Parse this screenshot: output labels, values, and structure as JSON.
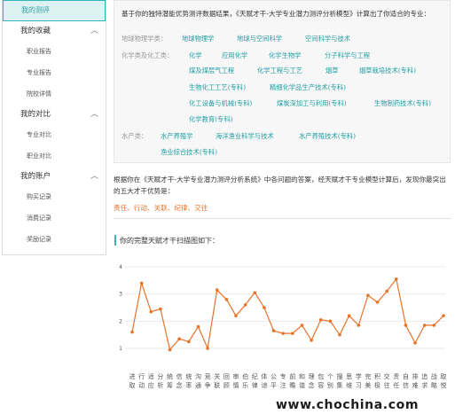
{
  "sidebar": {
    "active_item": "我的测评",
    "groups": [
      {
        "label": "我的收藏",
        "items": [
          "职业报告",
          "专业报告",
          "院校详情"
        ]
      },
      {
        "label": "我的对比",
        "items": [
          "专业对比",
          "职业对比"
        ]
      },
      {
        "label": "我的账户",
        "items": [
          "购买记录",
          "消费记录",
          "奖励记录"
        ]
      }
    ]
  },
  "recommend": {
    "intro": "基于你的独特潜能优势测评数据结果，《天赋才干-大学专业潜力测评分析模型》计算出了你适合的专业：",
    "categories": [
      {
        "label": "地球物理学类：",
        "items": [
          "地球物理学",
          "地球与空间科学",
          "空间科学与技术"
        ]
      },
      {
        "label": "化学类及化工类：",
        "items": [
          "化学",
          "应用化学",
          "化学生物学",
          "分子科学与工程",
          "煤及煤层气工程",
          "化学工程与工艺",
          "烟草",
          "烟草栽培技术(专科)",
          "生物化工工艺(专科)",
          "精细化学品生产技术(专科)",
          "化工设备与机械(专科)",
          "煤炭深加工与利用(专科)",
          "生物制药技术(专科)",
          "化学教育(专科)"
        ]
      },
      {
        "label": "水产类：",
        "items": [
          "水产养殖学",
          "海洋渔业科学与技术",
          "水产养殖技术(专科)",
          "渔业综合技术(专科)"
        ]
      }
    ]
  },
  "result": {
    "text": "根据你在《天赋才干-大学专业潜力测评分析系统》中各问题的答案，经天赋才干专业模型计算后，发现你最突出的五大才干优势是：",
    "talents": "责任、行动、关联、纪律、交往"
  },
  "chart_title": "你的完整天赋才干扫描图如下：",
  "chart_data": {
    "type": "line",
    "categories": [
      "进取",
      "行动",
      "适应",
      "分析",
      "统筹",
      "信念",
      "统率",
      "沟通",
      "竞争",
      "关联",
      "回顾",
      "审慎",
      "伯乐",
      "纪律",
      "体谅",
      "公平",
      "专注",
      "前瞻",
      "和谐",
      "理念",
      "包容",
      "个别",
      "搜集",
      "思维",
      "学习",
      "完美",
      "积极",
      "交往",
      "责任",
      "自信",
      "排难",
      "追求",
      "战略",
      "取悦"
    ],
    "values": [
      1.6,
      3.4,
      2.35,
      2.45,
      0.95,
      1.35,
      1.25,
      1.8,
      1.0,
      3.15,
      2.8,
      2.2,
      2.6,
      3.05,
      2.5,
      1.65,
      1.55,
      1.55,
      1.85,
      1.3,
      2.05,
      2.0,
      1.5,
      2.2,
      1.85,
      2.95,
      2.7,
      3.1,
      3.55,
      1.85,
      1.2,
      1.85,
      1.85,
      2.2
    ],
    "ylim": [
      1,
      4
    ],
    "yticks": [
      1,
      2,
      3,
      4
    ],
    "color": "#e8732a",
    "grid": true
  },
  "watermark": "www.chochina.com"
}
